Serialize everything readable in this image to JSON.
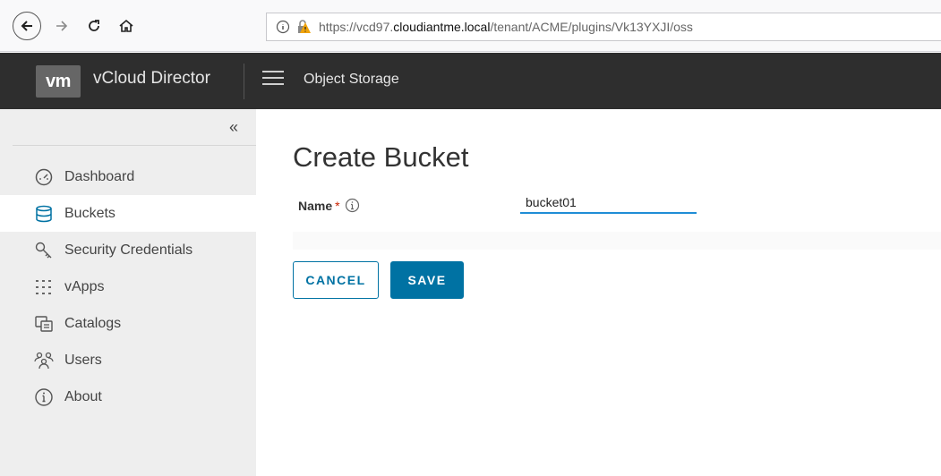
{
  "browser": {
    "url_prefix": "https://vcd97.",
    "url_host": "cloudiantme.local",
    "url_path": "/tenant/ACME/plugins/Vk13YXJI/oss"
  },
  "header": {
    "logo": "vm",
    "app_title": "vCloud Director",
    "section": "Object Storage"
  },
  "sidebar": {
    "collapse_glyph": "«",
    "items": [
      {
        "label": "Dashboard",
        "icon": "dashboard-icon",
        "active": false
      },
      {
        "label": "Buckets",
        "icon": "database-icon",
        "active": true
      },
      {
        "label": "Security Credentials",
        "icon": "key-icon",
        "active": false
      },
      {
        "label": "vApps",
        "icon": "vapps-grid-icon",
        "active": false
      },
      {
        "label": "Catalogs",
        "icon": "catalog-icon",
        "active": false
      },
      {
        "label": "Users",
        "icon": "users-icon",
        "active": false
      },
      {
        "label": "About",
        "icon": "info-icon",
        "active": false
      }
    ]
  },
  "main": {
    "title": "Create Bucket",
    "name_label": "Name",
    "required_mark": "*",
    "name_value": "bucket01",
    "cancel_label": "CANCEL",
    "save_label": "SAVE"
  },
  "colors": {
    "header_bg": "#2e2e2e",
    "sidebar_bg": "#eeeeee",
    "primary": "#0072a3",
    "input_underline": "#1f8dd6",
    "required": "#c92100"
  }
}
